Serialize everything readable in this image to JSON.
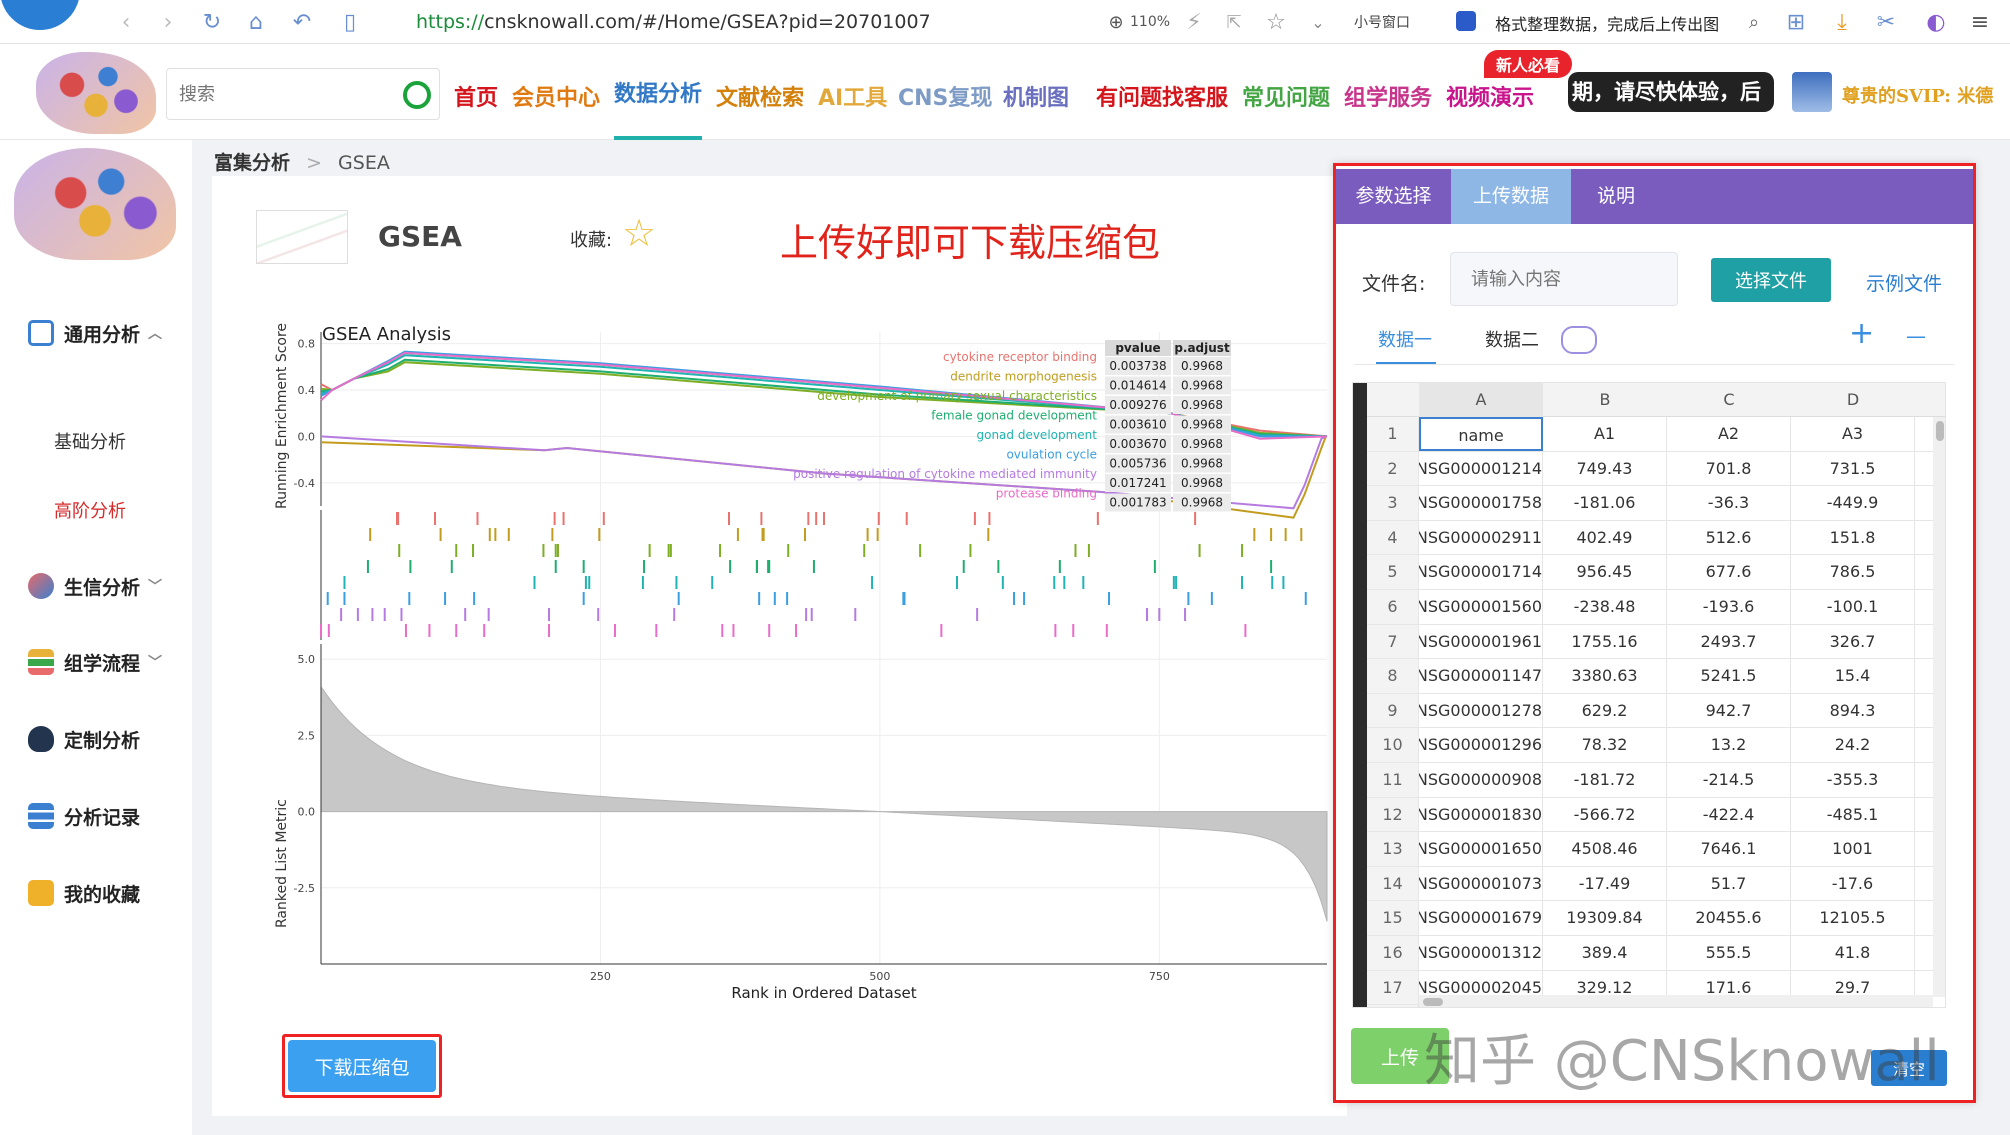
{
  "browser": {
    "url_proto": "https://",
    "url_rest": "cnsknowall.com/#/Home/GSEA?pid=20701007",
    "zoom": "110%",
    "small_window": "小号窗口",
    "ext_text": " 格式整理数据，完成后上传出图"
  },
  "header": {
    "search_placeholder": "搜索",
    "nav": [
      {
        "label": "首页",
        "color": "#d4161c"
      },
      {
        "label": "会员中心",
        "color": "#e07a10"
      },
      {
        "label": "数据分析",
        "color": "#3178c6"
      },
      {
        "label": "文献检索",
        "color": "#d4810c"
      },
      {
        "label": "AI工具",
        "color": "#e2a93a"
      },
      {
        "label": "CNS复现",
        "color": "#7d9bc5"
      },
      {
        "label": "机制图",
        "color": "#6a6fc0"
      },
      {
        "label": "有问题找客服",
        "color": "#d4161c"
      },
      {
        "label": "常见问题",
        "color": "#43a543"
      },
      {
        "label": "组学服务",
        "color": "#c8368c"
      },
      {
        "label": "视频演示",
        "color": "#c8158c"
      }
    ],
    "new_badge": "新人必看",
    "marquee": "期，请尽快体验，后",
    "svip": "尊贵的SVIP: 米德"
  },
  "sidebar": {
    "items": [
      {
        "label": "通用分析"
      },
      {
        "label": "基础分析"
      },
      {
        "label": "高阶分析"
      },
      {
        "label": "生信分析"
      },
      {
        "label": "组学流程"
      },
      {
        "label": "定制分析"
      },
      {
        "label": "分析记录"
      },
      {
        "label": "我的收藏"
      }
    ]
  },
  "breadcrumb": {
    "parent": "富集分析",
    "sep": ">",
    "current": "GSEA"
  },
  "tool": {
    "title": "GSEA",
    "fav_label": "收藏:",
    "annotation": "上传好即可下载压缩包",
    "download_button": "下载压缩包"
  },
  "chart_data": {
    "type": "line",
    "title": "GSEA Analysis",
    "ylabel": "Running Enrichment Score",
    "ylabel2": "Ranked List Metric",
    "xlabel": "Rank in Ordered Dataset",
    "x_ticks": [
      "250",
      "500",
      "750"
    ],
    "es_ticks": [
      "0.8",
      "0.4",
      "0.0",
      "-0.4"
    ],
    "metric_ticks": [
      "5.0",
      "2.5",
      "0.0",
      "-2.5"
    ],
    "table_headers": [
      "pvalue",
      "p.adjust"
    ],
    "series": [
      {
        "name": "cytokine receptor binding",
        "color": "#e8736e",
        "pvalue": "0.003738",
        "padjust": "0.9968"
      },
      {
        "name": "dendrite morphogenesis",
        "color": "#c29c1e",
        "pvalue": "0.014614",
        "padjust": "0.9968"
      },
      {
        "name": "development of primary sexual characteristics",
        "color": "#7eae24",
        "pvalue": "0.009276",
        "padjust": "0.9968"
      },
      {
        "name": "female gonad development",
        "color": "#1fae70",
        "pvalue": "0.003610",
        "padjust": "0.9968"
      },
      {
        "name": "gonad development",
        "color": "#1fb3b3",
        "pvalue": "0.003670",
        "padjust": "0.9968"
      },
      {
        "name": "ovulation cycle",
        "color": "#3a9ee0",
        "pvalue": "0.005736",
        "padjust": "0.9968"
      },
      {
        "name": "positive regulation of cytokine mediated immunity",
        "color": "#b57be0",
        "pvalue": "0.017241",
        "padjust": "0.9968"
      },
      {
        "name": "protease binding",
        "color": "#e86cc8",
        "pvalue": "0.001783",
        "padjust": "0.9968"
      }
    ]
  },
  "panel": {
    "tabs": [
      {
        "label": "参数选择"
      },
      {
        "label": "上传数据"
      },
      {
        "label": "说明"
      }
    ],
    "file_label": "文件名:",
    "file_placeholder": "请输入内容",
    "choose_file": "选择文件",
    "example_file": "示例文件",
    "data_tab1": "数据一",
    "data_tab2": "数据二",
    "plus": "+",
    "minus": "—",
    "upload_button": "上传",
    "clear_button": "清空"
  },
  "table": {
    "col_letters": [
      "A",
      "B",
      "C",
      "D"
    ],
    "rows": [
      {
        "n": "1",
        "a": "name",
        "b": "A1",
        "c": "A2",
        "d": "A3"
      },
      {
        "n": "2",
        "a": "NSG000001214",
        "b": "749.43",
        "c": "701.8",
        "d": "731.5"
      },
      {
        "n": "3",
        "a": "NSG000001758",
        "b": "-181.06",
        "c": "-36.3",
        "d": "-449.9"
      },
      {
        "n": "4",
        "a": "NSG000002911",
        "b": "402.49",
        "c": "512.6",
        "d": "151.8"
      },
      {
        "n": "5",
        "a": "NSG000001714",
        "b": "956.45",
        "c": "677.6",
        "d": "786.5"
      },
      {
        "n": "6",
        "a": "NSG000001560",
        "b": "-238.48",
        "c": "-193.6",
        "d": "-100.1"
      },
      {
        "n": "7",
        "a": "NSG000001961",
        "b": "1755.16",
        "c": "2493.7",
        "d": "326.7"
      },
      {
        "n": "8",
        "a": "NSG000001147",
        "b": "3380.63",
        "c": "5241.5",
        "d": "15.4"
      },
      {
        "n": "9",
        "a": "NSG000001278",
        "b": "629.2",
        "c": "942.7",
        "d": "894.3"
      },
      {
        "n": "10",
        "a": "NSG000001296",
        "b": "78.32",
        "c": "13.2",
        "d": "24.2"
      },
      {
        "n": "11",
        "a": "NSG000000908",
        "b": "-181.72",
        "c": "-214.5",
        "d": "-355.3"
      },
      {
        "n": "12",
        "a": "NSG000001830",
        "b": "-566.72",
        "c": "-422.4",
        "d": "-485.1"
      },
      {
        "n": "13",
        "a": "NSG000001650",
        "b": "4508.46",
        "c": "7646.1",
        "d": "1001"
      },
      {
        "n": "14",
        "a": "NSG000001073",
        "b": "-17.49",
        "c": "51.7",
        "d": "-17.6"
      },
      {
        "n": "15",
        "a": "NSG000001679",
        "b": "19309.84",
        "c": "20455.6",
        "d": "12105.5"
      },
      {
        "n": "16",
        "a": "NSG000001312",
        "b": "389.4",
        "c": "555.5",
        "d": "41.8"
      },
      {
        "n": "17",
        "a": "NSG000002045",
        "b": "329.12",
        "c": "171.6",
        "d": "29.7"
      }
    ]
  },
  "watermark": "知乎 @CNSknowall"
}
